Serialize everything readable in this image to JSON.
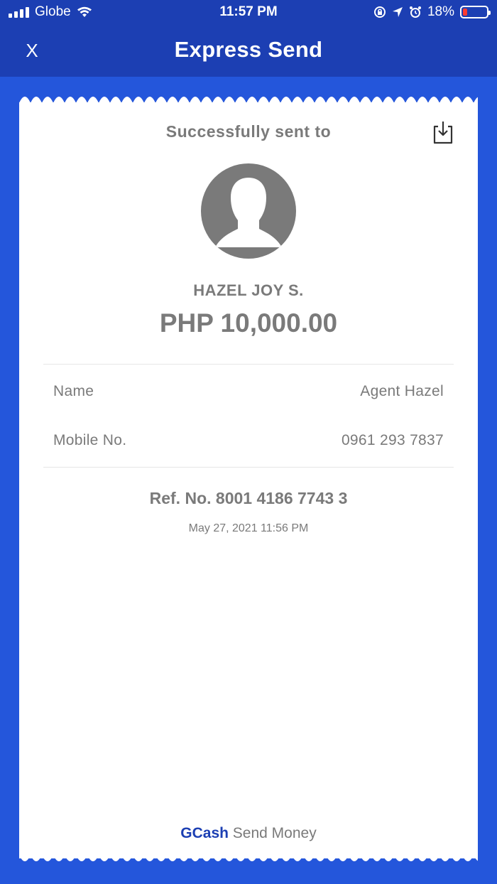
{
  "status_bar": {
    "carrier": "Globe",
    "time": "11:57 PM",
    "battery": "18%",
    "battery_level": 0.18
  },
  "nav": {
    "close_label": "X",
    "title": "Express Send"
  },
  "receipt": {
    "success_text": "Successfully sent to",
    "recipient_name": "HAZEL JOY S.",
    "amount": "PHP 10,000.00",
    "details": [
      {
        "label": "Name",
        "value": "Agent Hazel"
      },
      {
        "label": "Mobile No.",
        "value": "0961 293 7837"
      }
    ],
    "ref_no": "Ref. No. 8001 4186 7743 3",
    "timestamp": "May 27, 2021 11:56 PM",
    "footer_brand": "GCash",
    "footer_text": "Send Money"
  },
  "colors": {
    "background": "#2456db",
    "header": "#1c3fb3",
    "text_gray": "#7a7a7a",
    "brand_blue": "#1c3fb3"
  }
}
